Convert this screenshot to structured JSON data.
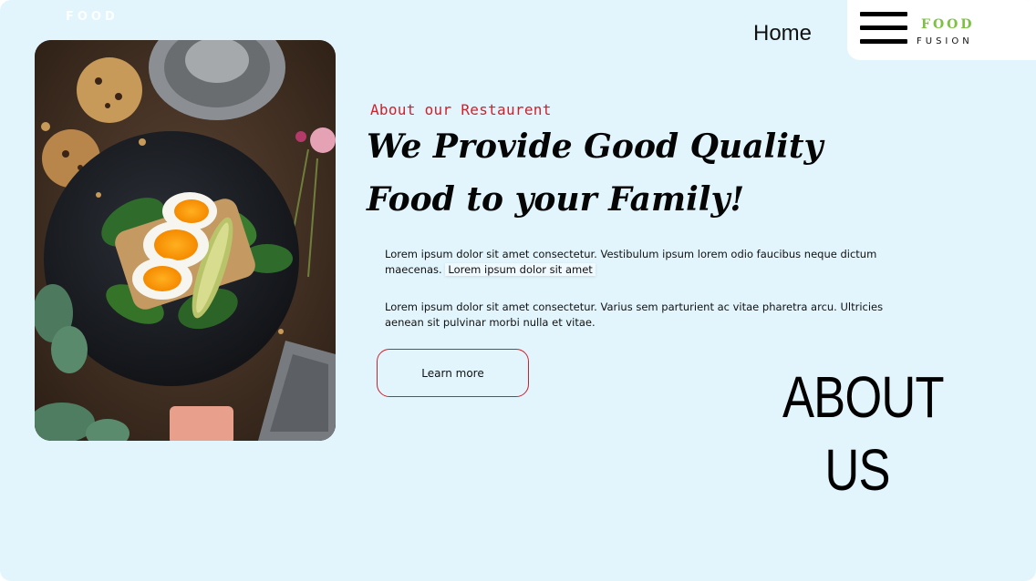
{
  "watermark": {
    "text": "FOOD"
  },
  "nav": {
    "home_label": "Home"
  },
  "brand": {
    "line1": "FOOD",
    "line2": "FUSION",
    "accent_color": "#7dc142"
  },
  "hero": {
    "eyebrow": "About our Restaurent",
    "headline_line1": "We Provide Good Quality",
    "headline_line2": "Food to your Family!",
    "para1_text": "Lorem ipsum dolor sit amet consectetur. Vestibulum ipsum lorem odio faucibus neque dictum maecenas.",
    "para1_highlight": "Lorem ipsum dolor sit amet",
    "para2_text": "Lorem ipsum dolor sit amet consectetur. Varius sem parturient ac vitae pharetra arcu. Ultricies aenean sit pulvinar morbi nulla et vitae.",
    "cta_label": "Learn more",
    "accent_color": "#d0202a"
  },
  "section_title": {
    "line1": "ABOUT",
    "line2": "US"
  },
  "colors": {
    "page_background": "#e2f5fd",
    "text": "#111111"
  }
}
